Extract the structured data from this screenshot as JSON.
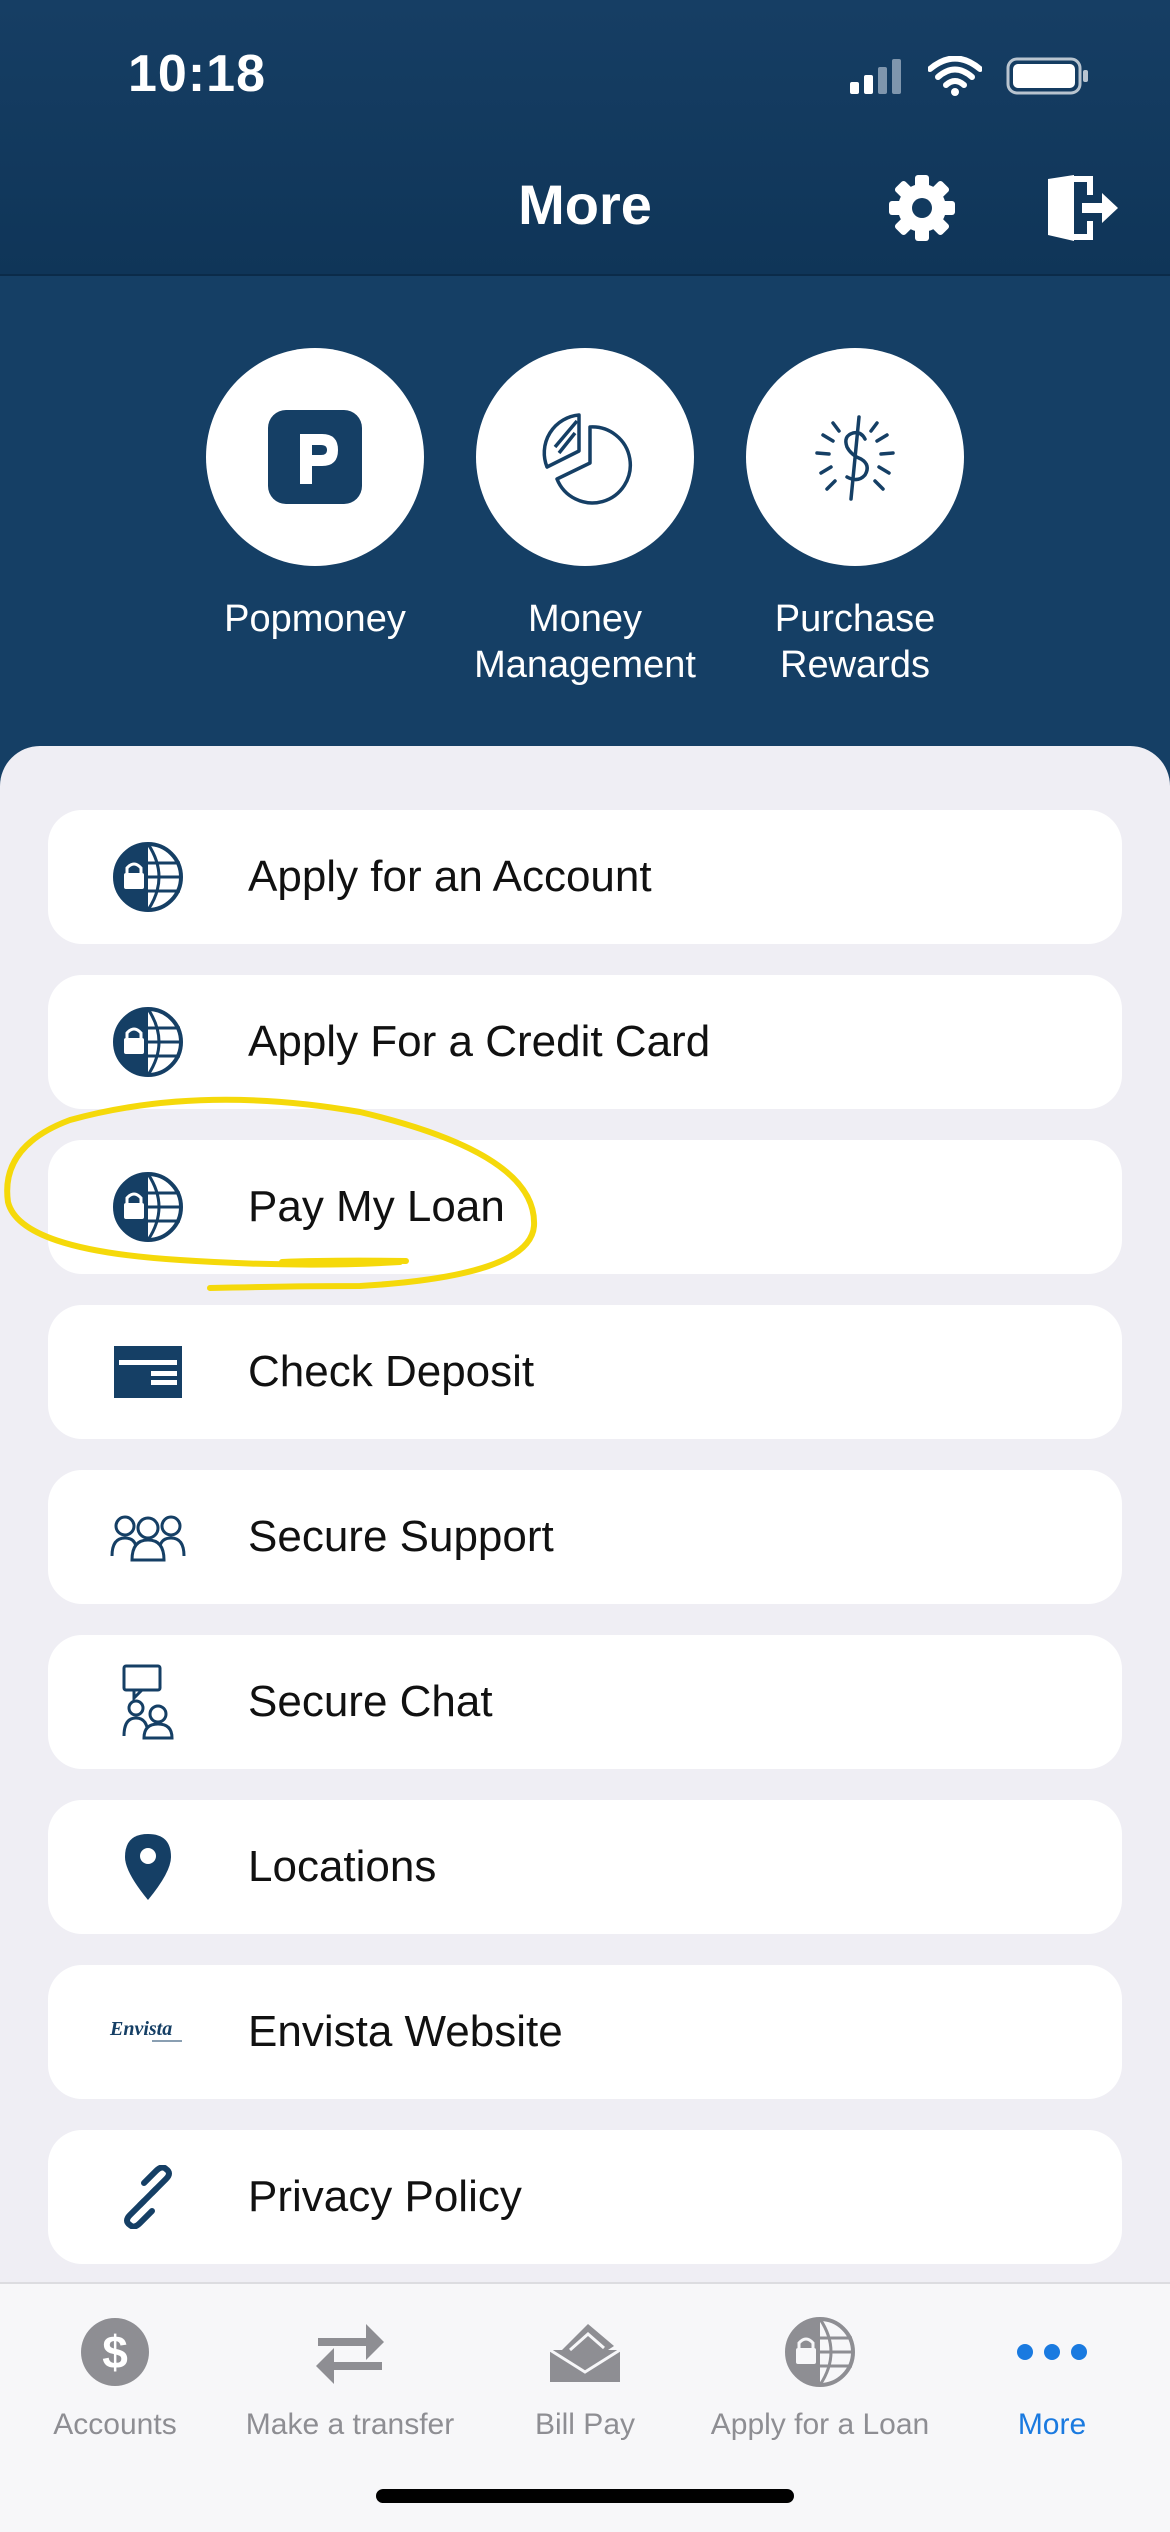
{
  "status": {
    "time": "10:18"
  },
  "header": {
    "title": "More",
    "settings_icon": "gear-icon",
    "logout_icon": "logout-icon"
  },
  "quick_actions": [
    {
      "label": "Popmoney",
      "icon": "popmoney-icon"
    },
    {
      "label": "Money Management",
      "icon": "pie-chart-icon"
    },
    {
      "label": "Purchase Rewards",
      "icon": "dollar-rewards-icon"
    }
  ],
  "menu": [
    {
      "label": "Apply for an Account",
      "icon": "lock-globe-icon"
    },
    {
      "label": "Apply For a Credit Card",
      "icon": "lock-globe-icon"
    },
    {
      "label": "Pay My Loan",
      "icon": "lock-globe-icon"
    },
    {
      "label": "Check Deposit",
      "icon": "check-card-icon"
    },
    {
      "label": "Secure Support",
      "icon": "group-icon"
    },
    {
      "label": "Secure Chat",
      "icon": "chat-people-icon"
    },
    {
      "label": "Locations",
      "icon": "map-pin-icon"
    },
    {
      "label": "Envista Website",
      "icon": "envista-logo-icon",
      "logo_text": "Envista"
    },
    {
      "label": "Privacy Policy",
      "icon": "link-icon"
    }
  ],
  "tabs": [
    {
      "label": "Accounts",
      "icon": "dollar-circle-icon",
      "active": false
    },
    {
      "label": "Make a transfer",
      "icon": "transfer-arrows-icon",
      "active": false
    },
    {
      "label": "Bill Pay",
      "icon": "bill-pay-icon",
      "active": false
    },
    {
      "label": "Apply for a Loan",
      "icon": "lock-globe-icon",
      "active": false
    },
    {
      "label": "More",
      "icon": "more-dots-icon",
      "active": true
    }
  ],
  "colors": {
    "navy": "#153f65",
    "accent": "#1a7ae0",
    "annotation": "#f5d90a"
  }
}
